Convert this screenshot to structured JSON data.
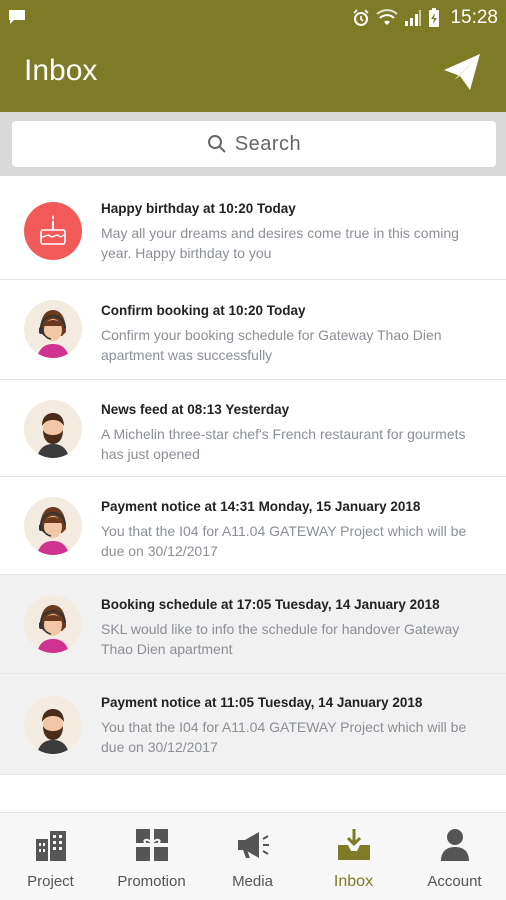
{
  "status": {
    "time": "15:28"
  },
  "header": {
    "title": "Inbox"
  },
  "search": {
    "placeholder": "Search"
  },
  "messages": [
    {
      "title": "Happy birthday at 10:20 Today",
      "body": "May all your dreams and desires come true in this coming year. Happy birthday to you",
      "avatar": "birthday-cake-icon",
      "shaded": false
    },
    {
      "title": "Confirm booking at 10:20 Today",
      "body": "Confirm your booking schedule for Gateway Thao Dien apartment was successfully",
      "avatar": "female-support-agent",
      "shaded": false
    },
    {
      "title": "News feed at 08:13 Yesterday",
      "body": "A Michelin three-star chef's French restaurant for gourmets has just opened",
      "avatar": "male-bearded",
      "shaded": false
    },
    {
      "title": "Payment notice at 14:31 Monday, 15 January 2018",
      "body": "You that the I04 for A11.04 GATEWAY Project which will be due on 30/12/2017",
      "avatar": "female-support-agent",
      "shaded": false
    },
    {
      "title": "Booking schedule at 17:05 Tuesday, 14 January 2018",
      "body": "SKL would like to info the schedule for handover Gateway Thao Dien apartment",
      "avatar": "female-support-agent",
      "shaded": true
    },
    {
      "title": "Payment notice at 11:05 Tuesday, 14 January 2018",
      "body": "You that the I04 for A11.04 GATEWAY Project which will be due on 30/12/2017",
      "avatar": "male-bearded",
      "shaded": true
    }
  ],
  "nav": [
    {
      "label": "Project",
      "icon": "buildings-icon",
      "active": false
    },
    {
      "label": "Promotion",
      "icon": "gift-icon",
      "active": false
    },
    {
      "label": "Media",
      "icon": "megaphone-icon",
      "active": false
    },
    {
      "label": "Inbox",
      "icon": "inbox-tray-icon",
      "active": true
    },
    {
      "label": "Account",
      "icon": "user-icon",
      "active": false
    }
  ],
  "colors": {
    "primary": "#7e7a26",
    "birthday": "#f25a5a",
    "body_text": "#8a8f96"
  }
}
